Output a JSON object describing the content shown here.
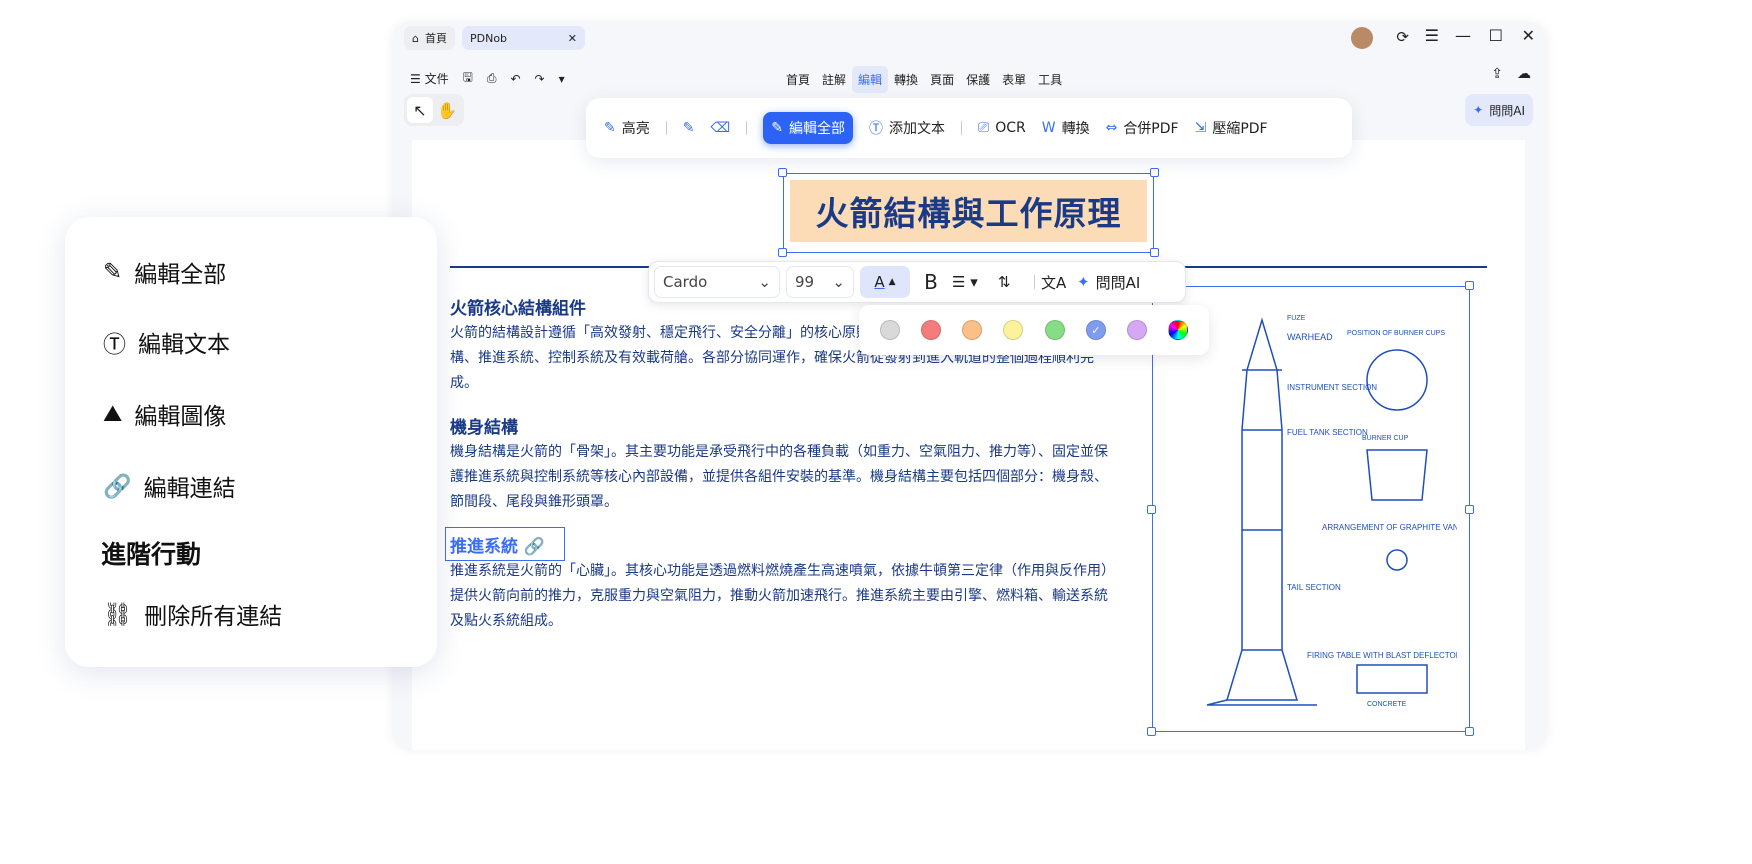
{
  "tabs": {
    "home": "首頁",
    "doc": "PDNob"
  },
  "toolbar": {
    "file": "文件"
  },
  "menu": [
    "首頁",
    "註解",
    "編輯",
    "轉換",
    "頁面",
    "保護",
    "表單",
    "工具"
  ],
  "menu_active": "編輯",
  "ask_ai": "問問AI",
  "edit_bar": {
    "highlight": "高亮",
    "edit_all": "編輯全部",
    "add_text": "添加文本",
    "ocr": "OCR",
    "convert": "轉換",
    "merge": "合併PDF",
    "compress": "壓縮PDF"
  },
  "format_bar": {
    "font": "Cardo",
    "size": "99",
    "ask_ai": "問問AI"
  },
  "colors": [
    "#d9d9d9",
    "#f47c7c",
    "#fbbf87",
    "#fbf29b",
    "#86dd86",
    "#7f9cf0",
    "#d5a8f5",
    "rainbow"
  ],
  "selected_color": "#7f9cf0",
  "document": {
    "title": "火箭結構與工作原理",
    "sections": [
      {
        "heading": "火箭核心結構組件",
        "body": "火箭的結構設計遵循「高效發射、穩定飛行、安全分離」的核心原則，主要由四大核心部分組成：機身結構、推進系統、控制系統及有效載荷艙。各部分協同運作，確保火箭從發射到進入軌道的整個過程順利完成。"
      },
      {
        "heading": "機身結構",
        "body": "機身結構是火箭的「骨架」。其主要功能是承受飛行中的各種負載（如重力、空氣阻力、推力等）、固定並保護推進系統與控制系統等核心內部設備，並提供各組件安裝的基準。機身結構主要包括四個部分：機身殼、節間段、尾段與錐形頭罩。"
      },
      {
        "heading": "推進系統",
        "body": "推進系統是火箭的「心臟」。其核心功能是透過燃料燃燒產生高速噴氣，依據牛頓第三定律（作用與反作用）提供火箭向前的推力，克服重力與空氣阻力，推動火箭加速飛行。推進系統主要由引擎、燃料箱、輸送系統及點火系統組成。"
      }
    ]
  },
  "blueprint": {
    "labels": [
      "FUZE",
      "WARHEAD",
      "INSTRUMENT SECTION",
      "FUEL TANK SECTION",
      "TAIL SECTION",
      "POSITION OF BURNER CUPS",
      "BURNER CUP",
      "ARRANGEMENT OF GRAPHITE VANES",
      "FIRING TABLE WITH BLAST DEFLECTOR",
      "CONCRETE"
    ]
  },
  "side_panel": {
    "items": [
      "編輯全部",
      "編輯文本",
      "編輯圖像",
      "編輯連結"
    ],
    "advanced": "進階行動",
    "remove_links": "刪除所有連結"
  }
}
